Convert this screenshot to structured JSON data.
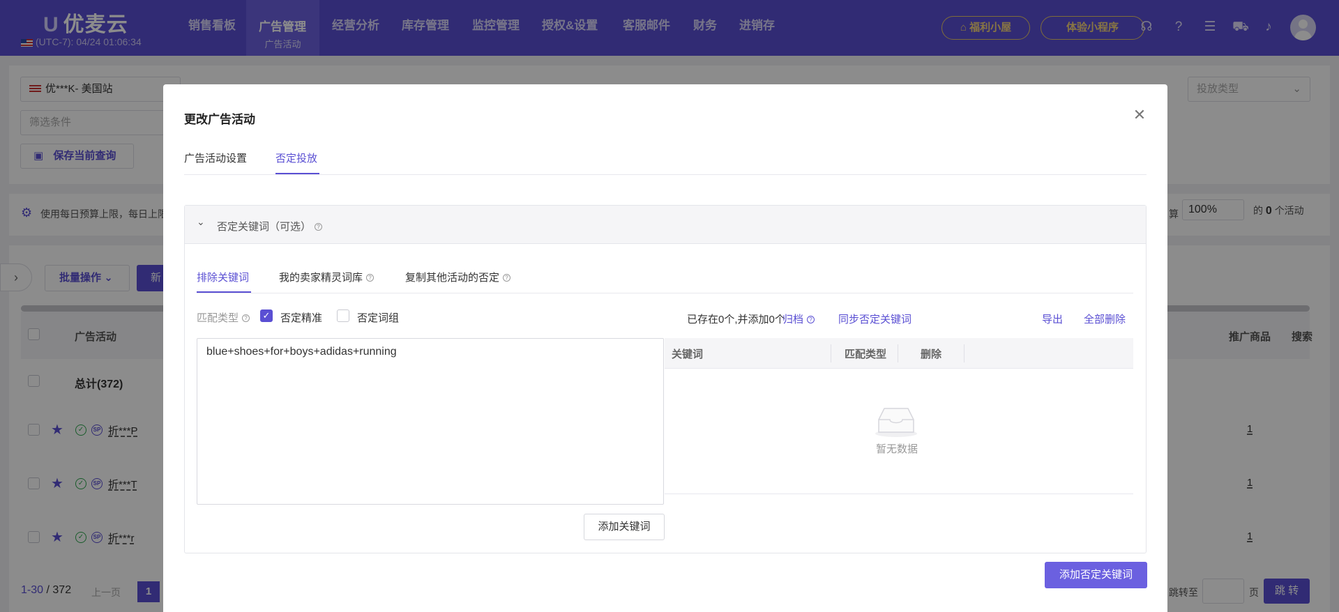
{
  "topbar": {
    "logo": "优麦云",
    "timezone": "(UTC-7): 04/24 01:06:34",
    "nav": [
      "销售看板",
      "广告管理",
      "经营分析",
      "库存管理",
      "监控管理",
      "授权&设置",
      "客服邮件",
      "财务",
      "进销存"
    ],
    "nav_active_sub": "广告活动",
    "welfare_btn": "福利小屋",
    "miniapp_btn": "体验小程序"
  },
  "background": {
    "store_select": "优***K- 美国站",
    "filter_placeholder": "筛选条件",
    "launch_type_placeholder": "投放类型",
    "save_query": "保存当前查询",
    "notice": "使用每日预算上限，每日上限",
    "notice_right_label": "算",
    "percent_value": "100%",
    "percent_suffix": "的",
    "percent_count": "0",
    "percent_unit": "个活动",
    "batch_ops": "批量操作",
    "new_btn": "新",
    "col_campaign": "广告活动",
    "col_products": "推广商品",
    "col_search": "搜索",
    "total_label": "总计(372)",
    "rows": [
      {
        "name": "折***P",
        "value": "1"
      },
      {
        "name": "折***T",
        "value": "1"
      },
      {
        "name": "折***r",
        "value": "1"
      }
    ],
    "pagination_range": "1-30",
    "pagination_sep": "/",
    "pagination_total": "372",
    "prev_page": "上一页",
    "current_page": "1",
    "goto_label": "跳转至",
    "page_unit": "页",
    "goto_btn": "跳 转"
  },
  "modal": {
    "title": "更改广告活动",
    "tabs": [
      "广告活动设置",
      "否定投放"
    ],
    "section_title": "否定关键词（可选）",
    "sub_tabs": [
      "排除关键词",
      "我的卖家精灵词库",
      "复制其他活动的否定"
    ],
    "match_type_label": "匹配类型",
    "match_exact": "否定精准",
    "match_phrase": "否定词组",
    "keyword_input_value": "blue+shoes+for+boys+adidas+running",
    "status_text": "已存在0个,并添加0个",
    "archive_link": "归档",
    "sync_link": "同步否定关键词",
    "export_link": "导出",
    "delete_all_link": "全部删除",
    "table_headers": [
      "关键词",
      "匹配类型",
      "删除"
    ],
    "empty_text": "暂无数据",
    "add_keyword_btn": "添加关键词",
    "add_negative_btn": "添加否定关键词"
  }
}
